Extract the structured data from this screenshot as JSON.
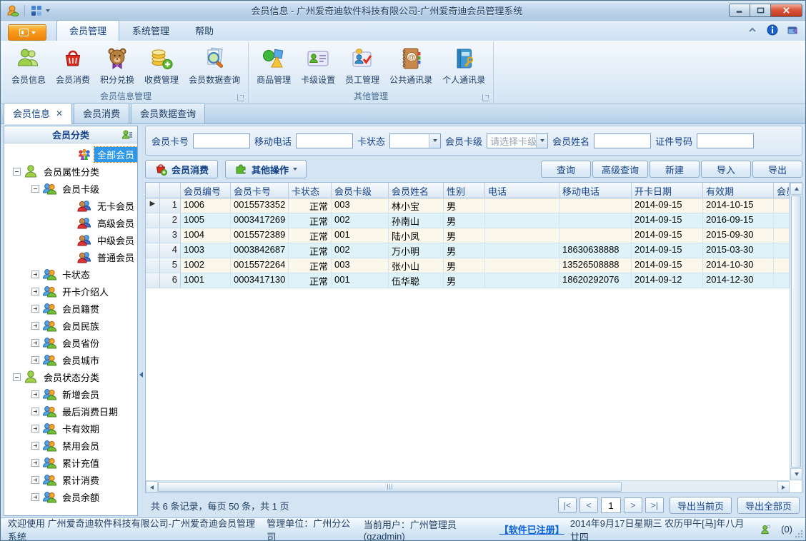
{
  "window": {
    "title": "会员信息 - 广州爱奇迪软件科技有限公司-广州爱奇迪会员管理系统"
  },
  "ribbon": {
    "tabs": [
      {
        "label": "会员管理",
        "active": true
      },
      {
        "label": "系统管理",
        "active": false
      },
      {
        "label": "帮助",
        "active": false
      }
    ],
    "groups": [
      {
        "label": "会员信息管理",
        "buttons": [
          {
            "label": "会员信息",
            "icon": "members-icon"
          },
          {
            "label": "会员消费",
            "icon": "basket-icon"
          },
          {
            "label": "积分兑换",
            "icon": "teddy-icon"
          },
          {
            "label": "收费管理",
            "icon": "coins-add-icon"
          },
          {
            "label": "会员数据查询",
            "icon": "doc-search-icon"
          }
        ]
      },
      {
        "label": "其他管理",
        "buttons": [
          {
            "label": "商品管理",
            "icon": "goods-icon"
          },
          {
            "label": "卡级设置",
            "icon": "card-settings-icon"
          },
          {
            "label": "员工管理",
            "icon": "staff-icon"
          },
          {
            "label": "公共通讯录",
            "icon": "public-contacts-icon"
          },
          {
            "label": "个人通讯录",
            "icon": "personal-contacts-icon"
          }
        ]
      }
    ]
  },
  "doc_tabs": [
    {
      "label": "会员信息",
      "active": true,
      "closable": true
    },
    {
      "label": "会员消费",
      "active": false,
      "closable": false
    },
    {
      "label": "会员数据查询",
      "active": false,
      "closable": false
    }
  ],
  "sidebar": {
    "header": "会员分类",
    "tree": [
      {
        "label": "全部会员",
        "level": 0,
        "icon": "crowd-icon",
        "expander": "none",
        "selected": true
      },
      {
        "label": "会员属性分类",
        "level": 0,
        "icon": "person-green-icon",
        "expander": "minus",
        "selected": false
      },
      {
        "label": "会员卡级",
        "level": 1,
        "icon": "pair-orange-icon",
        "expander": "minus",
        "selected": false
      },
      {
        "label": "无卡会员",
        "level": 2,
        "icon": "pair-red-icon",
        "expander": "none",
        "selected": false
      },
      {
        "label": "高级会员",
        "level": 2,
        "icon": "pair-red-icon",
        "expander": "none",
        "selected": false
      },
      {
        "label": "中级会员",
        "level": 2,
        "icon": "pair-red-icon",
        "expander": "none",
        "selected": false
      },
      {
        "label": "普通会员",
        "level": 2,
        "icon": "pair-red-icon",
        "expander": "none",
        "selected": false
      },
      {
        "label": "卡状态",
        "level": 1,
        "icon": "pair-orange-icon",
        "expander": "plus",
        "selected": false
      },
      {
        "label": "开卡介绍人",
        "level": 1,
        "icon": "pair-orange-icon",
        "expander": "plus",
        "selected": false
      },
      {
        "label": "会员籍贯",
        "level": 1,
        "icon": "pair-orange-icon",
        "expander": "plus",
        "selected": false
      },
      {
        "label": "会员民族",
        "level": 1,
        "icon": "pair-orange-icon",
        "expander": "plus",
        "selected": false
      },
      {
        "label": "会员省份",
        "level": 1,
        "icon": "pair-orange-icon",
        "expander": "plus",
        "selected": false
      },
      {
        "label": "会员城市",
        "level": 1,
        "icon": "pair-orange-icon",
        "expander": "plus",
        "selected": false
      },
      {
        "label": "会员状态分类",
        "level": 0,
        "icon": "person-green-icon",
        "expander": "minus",
        "selected": false
      },
      {
        "label": "新增会员",
        "level": 1,
        "icon": "pair-orange-icon",
        "expander": "plus",
        "selected": false
      },
      {
        "label": "最后消费日期",
        "level": 1,
        "icon": "pair-orange-icon",
        "expander": "plus",
        "selected": false
      },
      {
        "label": "卡有效期",
        "level": 1,
        "icon": "pair-orange-icon",
        "expander": "plus",
        "selected": false
      },
      {
        "label": "禁用会员",
        "level": 1,
        "icon": "pair-orange-icon",
        "expander": "plus",
        "selected": false
      },
      {
        "label": "累计充值",
        "level": 1,
        "icon": "pair-orange-icon",
        "expander": "plus",
        "selected": false
      },
      {
        "label": "累计消费",
        "level": 1,
        "icon": "pair-orange-icon",
        "expander": "plus",
        "selected": false
      },
      {
        "label": "会员余额",
        "level": 1,
        "icon": "pair-orange-icon",
        "expander": "plus",
        "selected": false
      }
    ]
  },
  "filters": {
    "fields": [
      {
        "name": "member-card-no",
        "label": "会员卡号",
        "type": "input",
        "value": ""
      },
      {
        "name": "mobile-phone",
        "label": "移动电话",
        "type": "input",
        "value": ""
      },
      {
        "name": "card-status",
        "label": "卡状态",
        "type": "select",
        "value": "",
        "placeholder": "",
        "width": 72
      },
      {
        "name": "card-level",
        "label": "会员卡级",
        "type": "select",
        "value": "",
        "placeholder": "请选择卡级",
        "width": 86
      },
      {
        "name": "member-name",
        "label": "会员姓名",
        "type": "input",
        "value": ""
      },
      {
        "name": "id-number",
        "label": "证件号码",
        "type": "input",
        "value": ""
      }
    ]
  },
  "toolbar": {
    "primary": [
      {
        "label": "会员消费",
        "icon": "basket-add-icon",
        "dropdown": false
      },
      {
        "label": "其他操作",
        "icon": "puzzle-icon",
        "dropdown": true
      }
    ],
    "actions": [
      "查询",
      "高级查询",
      "新建",
      "导入",
      "导出"
    ]
  },
  "table": {
    "current_row_marker": "▶",
    "columns": [
      "会员编号",
      "会员卡号",
      "卡状态",
      "会员卡级",
      "会员姓名",
      "性别",
      "电话",
      "移动电话",
      "开卡日期",
      "有效期",
      "会员"
    ],
    "rows": [
      {
        "num": "1",
        "current": true,
        "cells": [
          "1006",
          "0015573352",
          "正常",
          "003",
          "林小宝",
          "男",
          "",
          "",
          "2014-09-15",
          "2014-10-15",
          ""
        ]
      },
      {
        "num": "2",
        "current": false,
        "cells": [
          "1005",
          "0003417269",
          "正常",
          "002",
          "孙南山",
          "男",
          "",
          "",
          "2014-09-15",
          "2016-09-15",
          ""
        ]
      },
      {
        "num": "3",
        "current": false,
        "cells": [
          "1004",
          "0015572389",
          "正常",
          "001",
          "陆小凤",
          "男",
          "",
          "",
          "2014-09-15",
          "2015-09-30",
          ""
        ]
      },
      {
        "num": "4",
        "current": false,
        "cells": [
          "1003",
          "0003842687",
          "正常",
          "002",
          "万小明",
          "男",
          "",
          "18630638888",
          "2014-09-15",
          "2015-03-30",
          ""
        ]
      },
      {
        "num": "5",
        "current": false,
        "cells": [
          "1002",
          "0015572264",
          "正常",
          "003",
          "张小山",
          "男",
          "",
          "13526508888",
          "2014-09-15",
          "2014-10-30",
          ""
        ]
      },
      {
        "num": "6",
        "current": false,
        "cells": [
          "1001",
          "0003417130",
          "正常",
          "001",
          "伍华聪",
          "男",
          "",
          "18620292076",
          "2014-09-12",
          "2014-12-30",
          ""
        ]
      }
    ]
  },
  "pagination": {
    "summary": "共 6 条记录，每页 50 条，共 1 页",
    "pager": {
      "first": "|<",
      "prev": "<",
      "page": "1",
      "next": ">",
      "last": ">|"
    },
    "export_buttons": [
      "导出当前页",
      "导出全部页"
    ]
  },
  "statusbar": {
    "welcome": "欢迎使用 广州爱奇迪软件科技有限公司-广州爱奇迪会员管理系统",
    "unit": "管理单位：广州分公司",
    "user": "当前用户：广州管理员(gzadmin)",
    "registered": "【软件已注册】",
    "datetime": "2014年9月17日星期三 农历甲午[马]年八月廿四",
    "message_count": "(0)"
  }
}
